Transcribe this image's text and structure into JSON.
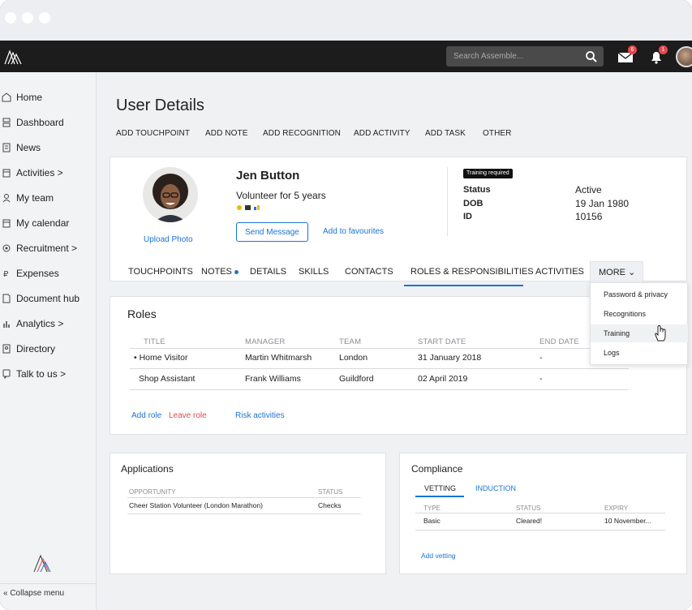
{
  "topbar": {
    "search_placeholder": "Search Assemble...",
    "messages_badge": "6",
    "notifications_badge": "1"
  },
  "sidebar": {
    "items": [
      {
        "label": "Home"
      },
      {
        "label": "Dashboard"
      },
      {
        "label": "News"
      },
      {
        "label": "Activities >"
      },
      {
        "label": "My team"
      },
      {
        "label": "My calendar"
      },
      {
        "label": "Recruitment >"
      },
      {
        "label": "Expenses"
      },
      {
        "label": "Document hub"
      },
      {
        "label": "Analytics >"
      },
      {
        "label": "Directory"
      },
      {
        "label": "Talk to us >"
      }
    ],
    "collapse_label": "« Collapse menu"
  },
  "page": {
    "title": "User Details",
    "actions": [
      "ADD TOUCHPOINT",
      "ADD NOTE",
      "ADD RECOGNITION",
      "ADD ACTIVITY",
      "ADD TASK",
      "OTHER"
    ]
  },
  "profile": {
    "name": "Jen Button",
    "subtitle": "Volunteer for 5 years",
    "upload_photo": "Upload Photo",
    "send_message": "Send Message",
    "add_favourites": "Add to favourites",
    "training_chip": "Training required",
    "status_label": "Status",
    "status_value": "Active",
    "dob_label": "DOB",
    "dob_value": "19 Jan 1980",
    "id_label": "ID",
    "id_value": "10156"
  },
  "tabs": {
    "items": [
      "TOUCHPOINTS",
      "NOTES",
      "DETAILS",
      "SKILLS",
      "CONTACTS",
      "ROLES & RESPONSIBILITIES",
      "ACTIVITIES",
      "MORE"
    ],
    "active": "ROLES & RESPONSIBILITIES",
    "more_chevron": "⌄"
  },
  "more_menu": {
    "items": [
      "Password & privacy",
      "Recognitions",
      "Training",
      "Logs"
    ],
    "hovered": "Training"
  },
  "roles": {
    "title": "Roles",
    "columns": [
      "TITLE",
      "MANAGER",
      "TEAM",
      "START DATE",
      "END DATE"
    ],
    "rows": [
      {
        "title": "• Home Visitor",
        "manager": "Martin Whitmarsh",
        "team": "London",
        "start": "31 January 2018",
        "end": "-"
      },
      {
        "title": "Shop Assistant",
        "manager": "Frank Williams",
        "team": "Guildford",
        "start": "02 April 2019",
        "end": "-"
      }
    ],
    "add_role": "Add role",
    "leave_role": "Leave role",
    "risk_activities": "Risk activities"
  },
  "applications": {
    "title": "Applications",
    "columns": [
      "OPPORTUNITY",
      "STATUS"
    ],
    "rows": [
      {
        "opportunity": "Cheer Station Volunteer  (London Marathon)",
        "status": "Checks"
      }
    ]
  },
  "compliance": {
    "title": "Compliance",
    "tabs": [
      "VETTING",
      "INDUCTION"
    ],
    "columns": [
      "TYPE",
      "STATUS",
      "EXPIRY"
    ],
    "rows": [
      {
        "type": "Basic",
        "status": "Cleared!",
        "expiry": "10 November..."
      }
    ],
    "add_vetting": "Add vetting"
  },
  "colors": {
    "accent": "#1a73d9",
    "danger": "#e5484d",
    "topbar": "#1c1c1c"
  }
}
